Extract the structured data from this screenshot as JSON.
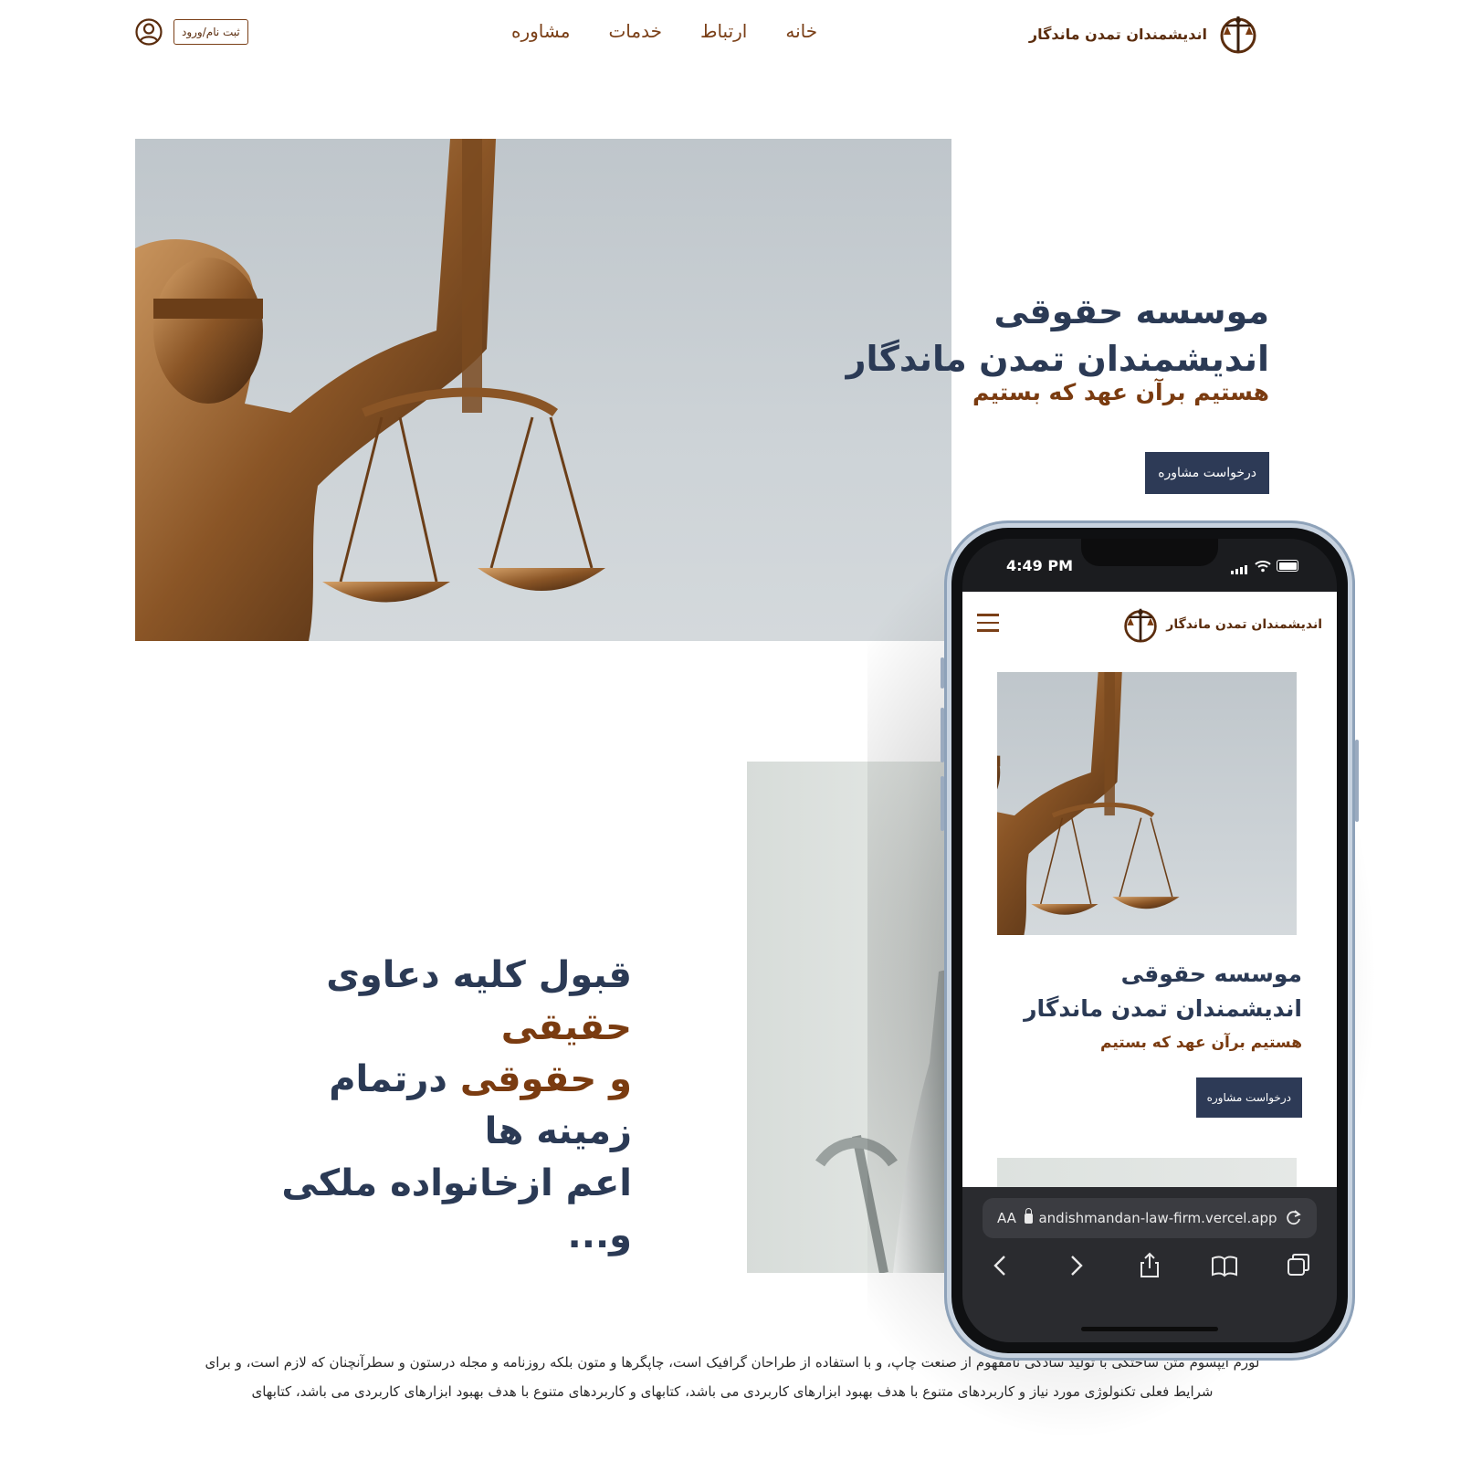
{
  "header": {
    "logo_text": "اندیشمندان تمدن ماندگار",
    "nav": [
      "خانه",
      "ارتباط",
      "خدمات",
      "مشاوره"
    ],
    "auth_label": "ثبت نام/ورود"
  },
  "hero": {
    "title": "موسسه حقوقی اندیشمندان تمدن ماندگار",
    "subtitle": "هستیم برآن عهد که بستیم",
    "cta": "درخواست مشاوره"
  },
  "section2": {
    "line1_a": "قبول کلیه دعاوی ",
    "line1_b": "حقیقی",
    "line2_a": "و حقوقی",
    "line2_b": " درتمام زمینه ها",
    "line3": "اعم ازخانواده ملکی و..."
  },
  "body_text": "لورم ایپسوم متن ساختگی با تولید سادگی نامفهوم از صنعت چاپ، و با استفاده از طراحان گرافیک است، چاپگرها و متون بلکه روزنامه و مجله درستون و سطرآنچنان که لازم است، و برای شرایط فعلی تکنولوژی مورد نیاز و کاربردهای متنوع با هدف بهبود ابزارهای کاربردی می باشد، کتابهای و کاربردهای متنوع با هدف بهبود ابزارهای کاربردی می باشد، کتابهای",
  "phone": {
    "time": "4:49 PM",
    "logo_text": "اندیشمندان تمدن ماندگار",
    "title": "موسسه حقوقی اندیشمندان تمدن ماندگار",
    "subtitle": "هستیم برآن عهد که بستیم",
    "cta": "درخواست مشاوره",
    "url_aa": "AA",
    "url": "andishmandan-law-firm.vercel.app"
  },
  "colors": {
    "navy": "#2b3a55",
    "brown": "#7a3b10",
    "button": "#2d3a56"
  }
}
